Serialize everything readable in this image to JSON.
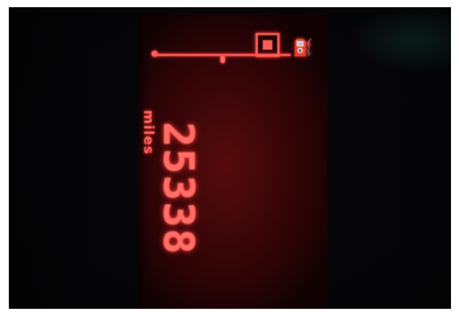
{
  "display": {
    "odometer_value": "25338",
    "odometer_unit": "miles",
    "fuel_icon": "fuel-pump-icon",
    "segment_glyph": "▣",
    "fuel_glyph": "⛽"
  },
  "colors": {
    "lcd_segment": "#ff6e66",
    "lcd_background": "#4a0608",
    "surround": "#050507"
  }
}
